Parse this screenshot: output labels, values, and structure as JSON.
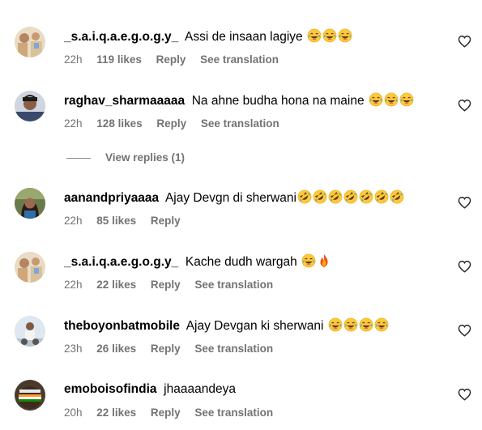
{
  "comments": [
    {
      "username": "_s.a.i.q.a.e.g.o.g.y_",
      "text": "Assi de insaan lagiye",
      "emojis": [
        "laugh",
        "laugh",
        "laugh"
      ],
      "time": "22h",
      "likes": "119 likes",
      "reply": "Reply",
      "translate": "See translation"
    },
    {
      "username": "raghav_sharmaaaaa",
      "text": "Na ahne budha hona na maine",
      "emojis": [
        "laugh",
        "laugh",
        "laugh"
      ],
      "time": "22h",
      "likes": "128 likes",
      "reply": "Reply",
      "translate": "See translation"
    },
    {
      "username": "aanandpriyaaaa",
      "text": "Ajay Devgn di sherwani",
      "emojis": [
        "rofl",
        "rofl",
        "rofl",
        "rofl",
        "rofl",
        "rofl",
        "rofl"
      ],
      "time": "22h",
      "likes": "85 likes",
      "reply": "Reply",
      "translate": ""
    },
    {
      "username": "_s.a.i.q.a.e.g.o.g.y_",
      "text": "Kache dudh wargah",
      "emojis": [
        "laugh",
        "fire"
      ],
      "time": "22h",
      "likes": "22 likes",
      "reply": "Reply",
      "translate": "See translation"
    },
    {
      "username": "theboyonbatmobile",
      "text": "Ajay Devgan ki sherwani",
      "emojis": [
        "laugh",
        "laugh",
        "laugh",
        "laugh"
      ],
      "time": "23h",
      "likes": "26 likes",
      "reply": "Reply",
      "translate": "See translation"
    },
    {
      "username": "emoboisofindia",
      "text": "jhaaaandeya",
      "emojis": [],
      "time": "20h",
      "likes": "22 likes",
      "reply": "Reply",
      "translate": "See translation"
    }
  ],
  "view_replies": "View replies (1)",
  "colors": {
    "meta": "#737373",
    "emoji_face": "#FFC83D",
    "tears": "#3BA7E8"
  },
  "icons": {
    "like": "heart-outline-icon"
  }
}
